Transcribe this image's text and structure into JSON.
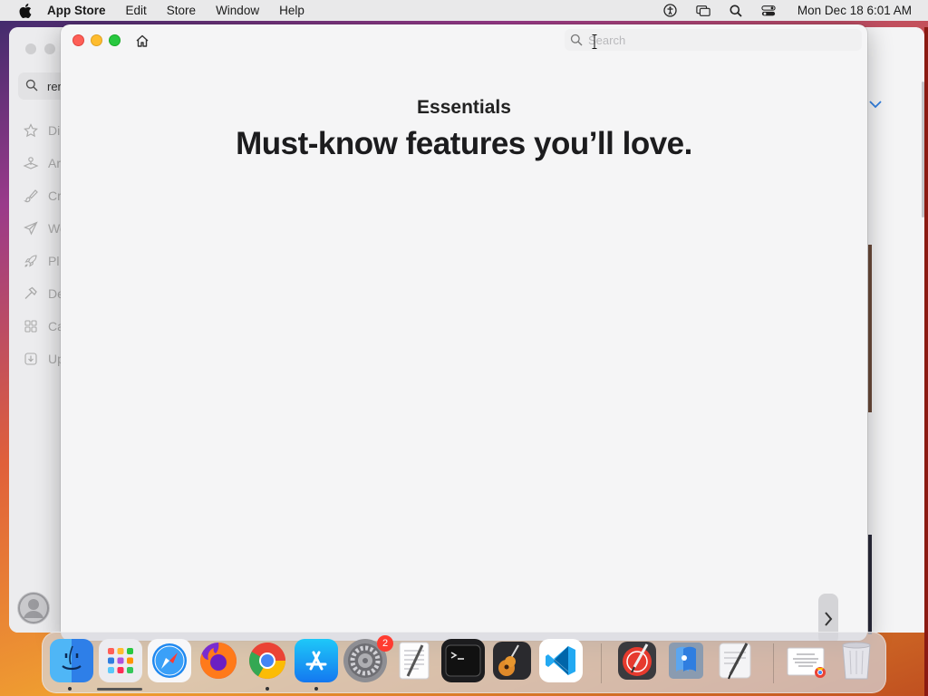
{
  "menubar": {
    "app_name": "App Store",
    "items": [
      "Edit",
      "Store",
      "Window",
      "Help"
    ],
    "clock": "Mon Dec 18  6:01 AM",
    "status_icons": [
      "accessibility-icon",
      "screen-mirroring-icon",
      "spotlight-icon",
      "control-center-icon"
    ]
  },
  "background_window": {
    "search_value": "ren",
    "sidebar_items": [
      {
        "icon": "star-icon",
        "label": "Di"
      },
      {
        "icon": "arcade-icon",
        "label": "Ar"
      },
      {
        "icon": "brush-icon",
        "label": "Cr"
      },
      {
        "icon": "paperplane-icon",
        "label": "Wo"
      },
      {
        "icon": "rocket-icon",
        "label": "Pl"
      },
      {
        "icon": "hammer-icon",
        "label": "De"
      },
      {
        "icon": "grid-icon",
        "label": "Ca"
      },
      {
        "icon": "download-icon",
        "label": "Up"
      }
    ]
  },
  "main_window": {
    "search_placeholder": "Search",
    "eyebrow": "Essentials",
    "title": "Must-know features you’ll love."
  },
  "dock": {
    "apps": [
      "Finder",
      "Launchpad",
      "Safari",
      "Firefox",
      "Google Chrome",
      "App Store",
      "System Settings",
      "TextEdit",
      "Terminal",
      "GarageBand",
      "Visual Studio Code",
      "Instruments",
      "Preview",
      "Script Editor",
      "Document",
      "Trash"
    ],
    "settings_badge": "2"
  },
  "colors": {
    "close": "#fe5f57",
    "minimize": "#febc2e",
    "maximize": "#28c840",
    "badge": "#ff3b30"
  }
}
